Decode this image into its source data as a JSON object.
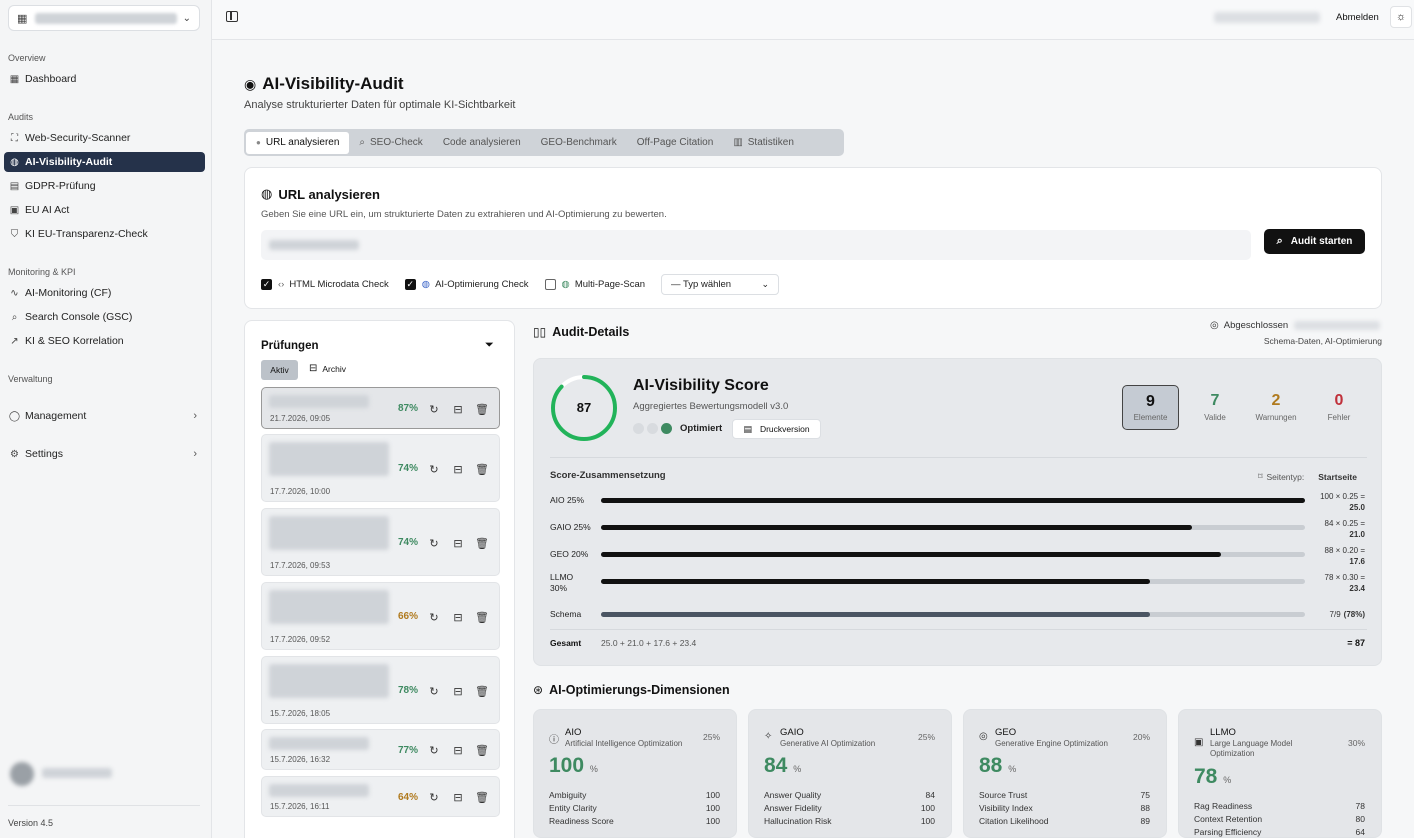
{
  "sidebar": {
    "groups": {
      "overview": "Overview",
      "audits": "Audits",
      "monitoring": "Monitoring & KPI",
      "verwaltung": "Verwaltung"
    },
    "items": [
      {
        "label": "Dashboard"
      },
      {
        "label": "Web-Security-Scanner"
      },
      {
        "label": "AI-Visibility-Audit"
      },
      {
        "label": "GDPR-Prüfung"
      },
      {
        "label": "EU AI Act"
      },
      {
        "label": "KI EU-Transparenz-Check"
      },
      {
        "label": "AI-Monitoring (CF)"
      },
      {
        "label": "Search Console (GSC)"
      },
      {
        "label": "KI & SEO Korrelation"
      },
      {
        "label": "Management"
      },
      {
        "label": "Settings"
      }
    ],
    "version": "Version 4.5"
  },
  "topbar": {
    "logout": "Abmelden"
  },
  "page": {
    "title": "AI-Visibility-Audit",
    "subtitle": "Analyse strukturierter Daten für optimale KI-Sichtbarkeit"
  },
  "tabs": [
    "URL analysieren",
    "SEO-Check",
    "Code analysieren",
    "GEO-Benchmark",
    "Off-Page Citation",
    "Statistiken"
  ],
  "url_card": {
    "title": "URL analysieren",
    "desc": "Geben Sie eine URL ein, um strukturierte Daten zu extrahieren und AI-Optimierung zu bewerten.",
    "button": "Audit starten",
    "checks": [
      "HTML Microdata Check",
      "AI-Optimierung Check",
      "Multi-Page-Scan"
    ],
    "checked": [
      true,
      true,
      false
    ],
    "select": "— Typ wählen"
  },
  "pruefungen": {
    "title": "Prüfungen",
    "tab_active": "Aktiv",
    "tab_archive": "Archiv",
    "items": [
      {
        "date": "21.7.2026, 09:05",
        "pct": "87%",
        "color": "#3e8a61"
      },
      {
        "date": "17.7.2026, 10:00",
        "pct": "74%",
        "color": "#3e8a61"
      },
      {
        "date": "17.7.2026, 09:53",
        "pct": "74%",
        "color": "#3e8a61"
      },
      {
        "date": "17.7.2026, 09:52",
        "pct": "66%",
        "color": "#b07a1e"
      },
      {
        "date": "15.7.2026, 18:05",
        "pct": "78%",
        "color": "#3e8a61"
      },
      {
        "date": "15.7.2026, 16:32",
        "pct": "77%",
        "color": "#3e8a61"
      },
      {
        "date": "15.7.2026, 16:11",
        "pct": "64%",
        "color": "#b07a1e"
      }
    ]
  },
  "audit_details": {
    "title": "Audit-Details",
    "status": "Abgeschlossen",
    "meta": "Schema-Daten, AI-Optimierung"
  },
  "score": {
    "value": "87",
    "value_num": 87,
    "title": "AI-Visibility Score",
    "subtitle": "Aggregiertes Bewertungsmodell v3.0",
    "status": "Optimiert",
    "print": "Druckversion",
    "stats": [
      {
        "value": "9",
        "label": "Elemente",
        "color": "#111"
      },
      {
        "value": "7",
        "label": "Valide",
        "color": "#3e8a61"
      },
      {
        "value": "2",
        "label": "Warnungen",
        "color": "#b07a1e"
      },
      {
        "value": "0",
        "label": "Fehler",
        "color": "#c0303a"
      }
    ]
  },
  "composition": {
    "title": "Score-Zusammensetzung",
    "page_type_label": "Seitentyp:",
    "page_type": "Startseite",
    "rows": [
      {
        "label": "AIO 25%",
        "value": 100,
        "formula": "100 × 0.25 =",
        "result": "25.0"
      },
      {
        "label": "GAIO 25%",
        "value": 84,
        "formula": "84 × 0.25 =",
        "result": "21.0"
      },
      {
        "label": "GEO 20%",
        "value": 88,
        "formula": "88 × 0.20 =",
        "result": "17.6"
      },
      {
        "label": "LLMO 30%",
        "value": 78,
        "formula": "78 × 0.30 =",
        "result": "23.4"
      }
    ],
    "schema": {
      "label": "Schema",
      "value": 78,
      "text": "7/9",
      "pct": "(78%)"
    },
    "total": {
      "label": "Gesamt",
      "formula": "25.0 + 21.0 + 17.6 + 23.4",
      "result": "= 87"
    }
  },
  "dimensions": {
    "title": "AI-Optimierungs-Dimensionen",
    "cards": [
      {
        "icon": "info-icon",
        "name": "AIO",
        "sub": "Artificial Intelligence Optimization",
        "weight": "25%",
        "value": "100",
        "unit": "%",
        "metrics": [
          [
            "Ambiguity",
            "100"
          ],
          [
            "Entity Clarity",
            "100"
          ],
          [
            "Readiness Score",
            "100"
          ]
        ]
      },
      {
        "icon": "sparkle-icon",
        "name": "GAIO",
        "sub": "Generative AI Optimization",
        "weight": "25%",
        "value": "84",
        "unit": "%",
        "metrics": [
          [
            "Answer Quality",
            "84"
          ],
          [
            "Answer Fidelity",
            "100"
          ],
          [
            "Hallucination Risk",
            "100"
          ]
        ]
      },
      {
        "icon": "target-icon",
        "name": "GEO",
        "sub": "Generative Engine Optimization",
        "weight": "20%",
        "value": "88",
        "unit": "%",
        "metrics": [
          [
            "Source Trust",
            "75"
          ],
          [
            "Visibility Index",
            "88"
          ],
          [
            "Citation Likelihood",
            "89"
          ]
        ]
      },
      {
        "icon": "chip-icon",
        "name": "LLMO",
        "sub": "Large Language Model Optimization",
        "weight": "30%",
        "value": "78",
        "unit": "%",
        "metrics": [
          [
            "Rag Readiness",
            "78"
          ],
          [
            "Context Retention",
            "80"
          ],
          [
            "Parsing Efficiency",
            "64"
          ]
        ]
      }
    ]
  }
}
